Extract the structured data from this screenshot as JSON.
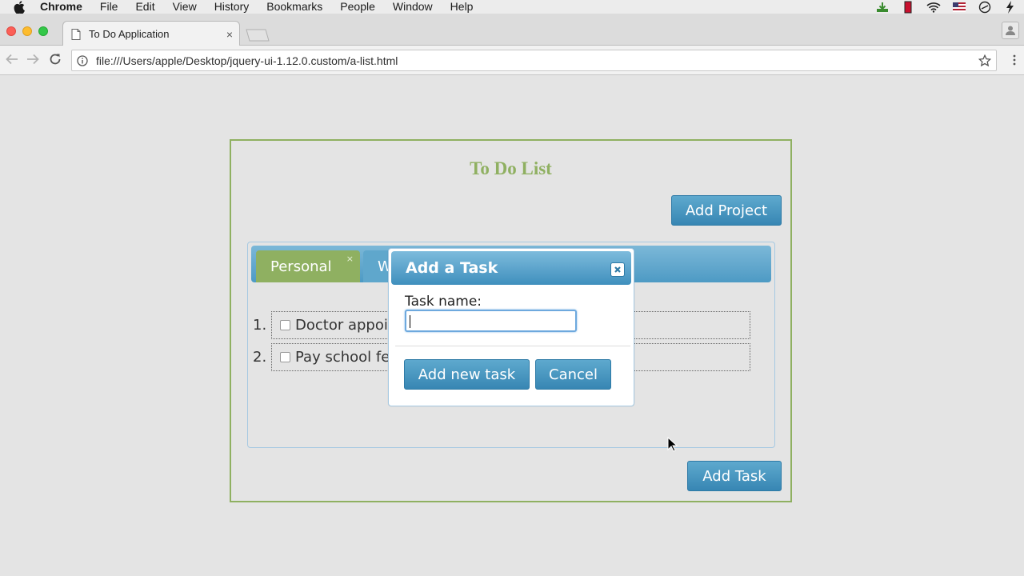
{
  "menubar": {
    "items": [
      "Chrome",
      "File",
      "Edit",
      "View",
      "History",
      "Bookmarks",
      "People",
      "Window",
      "Help"
    ]
  },
  "browser": {
    "tab_title": "To Do Application",
    "tab_close": "×",
    "url": "file:///Users/apple/Desktop/jquery-ui-1.12.0.custom/a-list.html"
  },
  "app": {
    "title": "To Do List",
    "add_project_label": "Add Project",
    "add_task_label": "Add Task",
    "tabs": [
      {
        "label": "Personal",
        "close": "×"
      },
      {
        "label": "W"
      }
    ],
    "tasks": [
      {
        "num": "1.",
        "text": "Doctor appoi"
      },
      {
        "num": "2.",
        "text": "Pay school fe"
      }
    ]
  },
  "dialog": {
    "title": "Add a Task",
    "field_label": "Task name:",
    "field_value": "",
    "add_button": "Add new task",
    "cancel_button": "Cancel"
  },
  "colors": {
    "accent_green": "#8fb061",
    "accent_blue": "#3f8fbd",
    "page_bg": "#e4e4e4"
  }
}
